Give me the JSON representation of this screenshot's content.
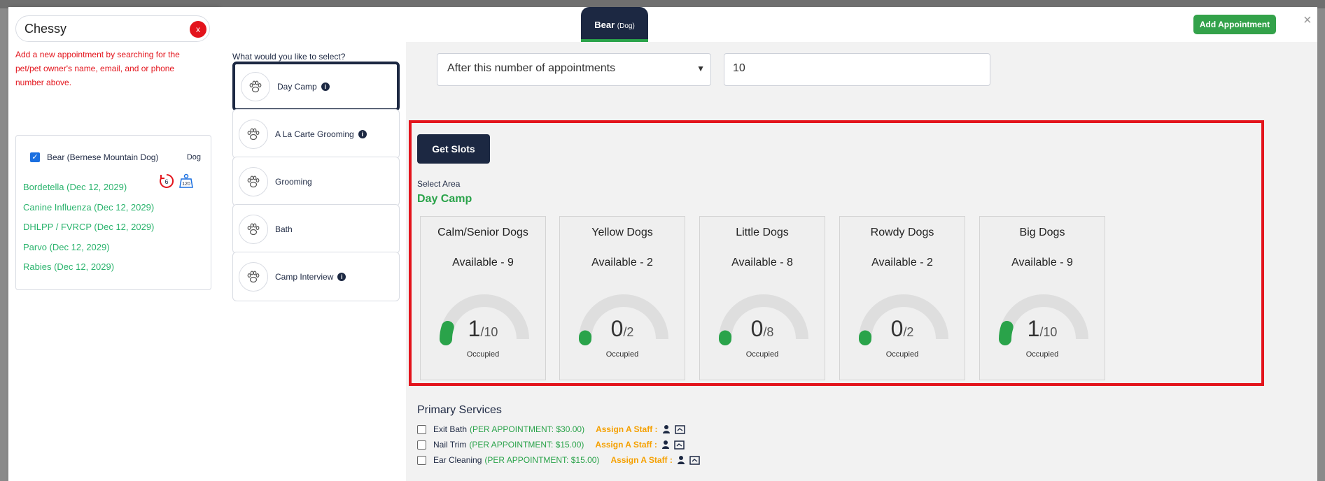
{
  "search": {
    "value": "Chessy",
    "clear_label": "x",
    "hint": "Add a new appointment by searching for the pet/pet owner's name, email, and or phone number above."
  },
  "pet": {
    "name": "Bear (Bernese Mountain Dog)",
    "species": "Dog",
    "badge_count_a": "6",
    "badge_count_b": "120",
    "vaccinations": [
      "Bordetella (Dec 12, 2029)",
      "Canine Influenza (Dec 12, 2029)",
      "DHLPP / FVRCP (Dec 12, 2029)",
      "Parvo (Dec 12, 2029)",
      "Rabies (Dec 12, 2029)"
    ]
  },
  "header": {
    "tab_name": "Bear",
    "tab_species": "(Dog)",
    "add_appointment": "Add Appointment",
    "close": "×"
  },
  "services_panel": {
    "prompt": "What would you like to select?",
    "options": [
      {
        "label": "Day Camp",
        "info": true,
        "active": true
      },
      {
        "label": "A La Carte Grooming",
        "info": true,
        "active": false
      },
      {
        "label": "Grooming",
        "info": false,
        "active": false
      },
      {
        "label": "Bath",
        "info": false,
        "active": false
      },
      {
        "label": "Camp Interview",
        "info": true,
        "active": false
      }
    ]
  },
  "condition": {
    "select_value": "After this number of appointments",
    "number_value": "10"
  },
  "slots": {
    "button": "Get Slots",
    "area_label": "Select Area",
    "area_name": "Day Camp",
    "occupied_label": "Occupied",
    "areas": [
      {
        "title": "Calm/Senior Dogs",
        "available": "Available - 9",
        "occupied": 1,
        "capacity": 10
      },
      {
        "title": "Yellow Dogs",
        "available": "Available - 2",
        "occupied": 0,
        "capacity": 2
      },
      {
        "title": "Little Dogs",
        "available": "Available - 8",
        "occupied": 0,
        "capacity": 8
      },
      {
        "title": "Rowdy Dogs",
        "available": "Available - 2",
        "occupied": 0,
        "capacity": 2
      },
      {
        "title": "Big Dogs",
        "available": "Available - 9",
        "occupied": 1,
        "capacity": 10
      }
    ]
  },
  "primary_services": {
    "title": "Primary Services",
    "assign_label": "Assign A Staff :",
    "items": [
      {
        "name": "Exit Bath",
        "price": "(PER APPOINTMENT: $30.00)"
      },
      {
        "name": "Nail Trim",
        "price": "(PER APPOINTMENT: $15.00)"
      },
      {
        "name": "Ear Cleaning",
        "price": "(PER APPOINTMENT: $15.00)"
      }
    ]
  },
  "colors": {
    "navy": "#1c2842",
    "green": "#2aa34a",
    "red": "#e3141c",
    "orange": "#f5a000"
  }
}
